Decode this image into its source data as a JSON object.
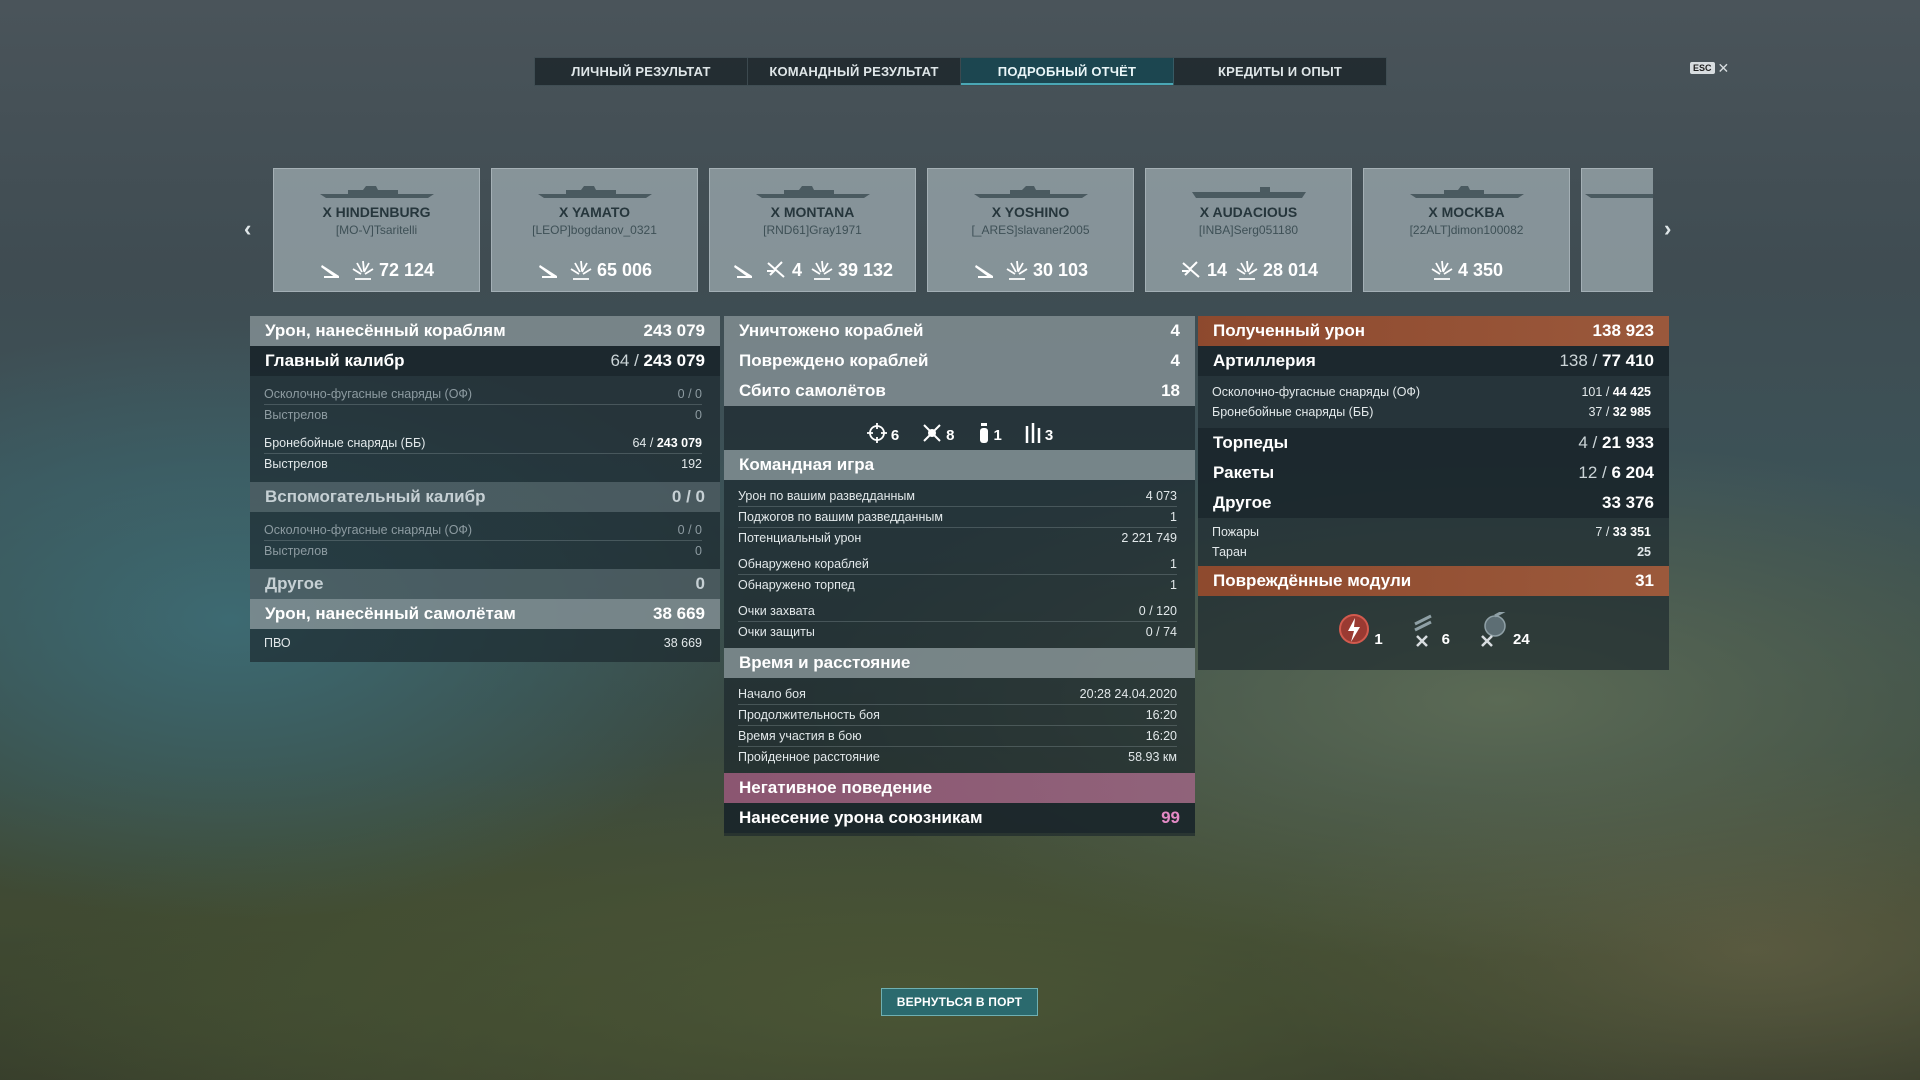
{
  "tabs": [
    "ЛИЧНЫЙ РЕЗУЛЬТАТ",
    "КОМАНДНЫЙ РЕЗУЛЬТАТ",
    "ПОДРОБНЫЙ ОТЧЁТ",
    "КРЕДИТЫ И ОПЫТ"
  ],
  "active_tab": "ПОДРОБНЫЙ ОТЧЁТ",
  "esc": {
    "key": "ESC",
    "close": "✕"
  },
  "nav": {
    "prev": "‹",
    "next": "›"
  },
  "ships": [
    {
      "name": "X HINDENBURG",
      "player": "[MO-V]Tsaritelli",
      "torp": "",
      "planes": "",
      "damage": "72 124"
    },
    {
      "name": "X YAMATO",
      "player": "[LEOP]bogdanov_0321",
      "torp": "",
      "planes": "",
      "damage": "65 006"
    },
    {
      "name": "X MONTANA",
      "player": "[RND61]Gray1971",
      "torp": "",
      "planes": "4",
      "damage": "39 132"
    },
    {
      "name": "X YOSHINO",
      "player": "[_ARES]slavaner2005",
      "torp": "",
      "planes": "",
      "damage": "30 103"
    },
    {
      "name": "X AUDACIOUS",
      "player": "[INBA]Serg051180",
      "torp": null,
      "planes": "14",
      "damage": "28 014"
    },
    {
      "name": "X MOCKBA",
      "player": "[22ALT]dimon100082",
      "torp": null,
      "planes": null,
      "damage": "4 350"
    }
  ],
  "left": {
    "ship_damage": {
      "label": "Урон, нанесённый кораблям",
      "value": "243 079"
    },
    "main": {
      "label": "Главный калибр",
      "hits": "64",
      "value": "243 079"
    },
    "he": {
      "label": "Осколочно-фугасные снаряды (ОФ)",
      "value": "0 / 0"
    },
    "he_shots": {
      "label": "Выстрелов",
      "value": "0"
    },
    "ap": {
      "label": "Бронебойные снаряды (ББ)",
      "hits": "64",
      "value": "243 079"
    },
    "ap_shots": {
      "label": "Выстрелов",
      "value": "192"
    },
    "secondary": {
      "label": "Вспомогательный калибр",
      "value": "0 / 0"
    },
    "sec_he": {
      "label": "Осколочно-фугасные снаряды (ОФ)",
      "value": "0 / 0"
    },
    "sec_shots": {
      "label": "Выстрелов",
      "value": "0"
    },
    "other": {
      "label": "Другое",
      "value": "0"
    },
    "plane_damage": {
      "label": "Урон, нанесённый самолётам",
      "value": "38 669"
    },
    "aa": {
      "label": "ПВО",
      "value": "38 669"
    }
  },
  "middle": {
    "destroyed": {
      "label": "Уничтожено кораблей",
      "value": "4"
    },
    "damaged": {
      "label": "Повреждено кораблей",
      "value": "4"
    },
    "planes_shot": {
      "label": "Сбито самолётов",
      "value": "18"
    },
    "plane_icons": [
      {
        "icon": "crosshair-icon",
        "value": "6"
      },
      {
        "icon": "skull-plane-icon",
        "value": "8"
      },
      {
        "icon": "bomb-icon",
        "value": "1"
      },
      {
        "icon": "rockets-icon",
        "value": "3"
      }
    ],
    "team": {
      "label": "Командная игра"
    },
    "spot_damage": {
      "label": "Урон по вашим разведданным",
      "value": "4 073"
    },
    "spot_fires": {
      "label": "Поджогов по вашим разведданным",
      "value": "1"
    },
    "potential": {
      "label": "Потенциальный урон",
      "value": "2 221 749"
    },
    "spotted_ships": {
      "label": "Обнаружено кораблей",
      "value": "1"
    },
    "spotted_torps": {
      "label": "Обнаружено торпед",
      "value": "1"
    },
    "capture": {
      "label": "Очки захвата",
      "value": "0 / 120"
    },
    "defense": {
      "label": "Очки защиты",
      "value": "0 / 74"
    },
    "time": {
      "label": "Время и расстояние"
    },
    "start": {
      "label": "Начало боя",
      "value": "20:28  24.04.2020"
    },
    "duration": {
      "label": "Продолжительность боя",
      "value": "16:20"
    },
    "participation": {
      "label": "Время участия в бою",
      "value": "16:20"
    },
    "distance": {
      "label": "Пройденное расстояние",
      "value": "58.93 км"
    },
    "negative": {
      "label": "Негативное поведение"
    },
    "team_damage": {
      "label": "Нанесение урона союзникам",
      "value": "99"
    }
  },
  "right": {
    "received": {
      "label": "Полученный урон",
      "value": "138 923"
    },
    "artillery": {
      "label": "Артиллерия",
      "hits": "138",
      "value": "77 410"
    },
    "he": {
      "label": "Осколочно-фугасные снаряды (ОФ)",
      "hits": "101",
      "value": "44 425"
    },
    "ap": {
      "label": "Бронебойные снаряды (ББ)",
      "hits": "37",
      "value": "32 985"
    },
    "torpedoes": {
      "label": "Торпеды",
      "hits": "4",
      "value": "21 933"
    },
    "rockets": {
      "label": "Ракеты",
      "hits": "12",
      "value": "6 204"
    },
    "other": {
      "label": "Другое",
      "value": "33 376"
    },
    "fires": {
      "label": "Пожары",
      "hits": "7",
      "value": "33 351"
    },
    "ram": {
      "label": "Таран",
      "value": "25"
    },
    "modules": {
      "label": "Повреждённые модули",
      "value": "31"
    },
    "module_icons": [
      {
        "icon": "engine-damage-icon",
        "value": "1"
      },
      {
        "icon": "torpedo-tube-damage-icon",
        "value": "6"
      },
      {
        "icon": "turret-damage-icon",
        "value": "24"
      }
    ]
  },
  "return_button": "ВЕРНУТЬСЯ В ПОРТ"
}
